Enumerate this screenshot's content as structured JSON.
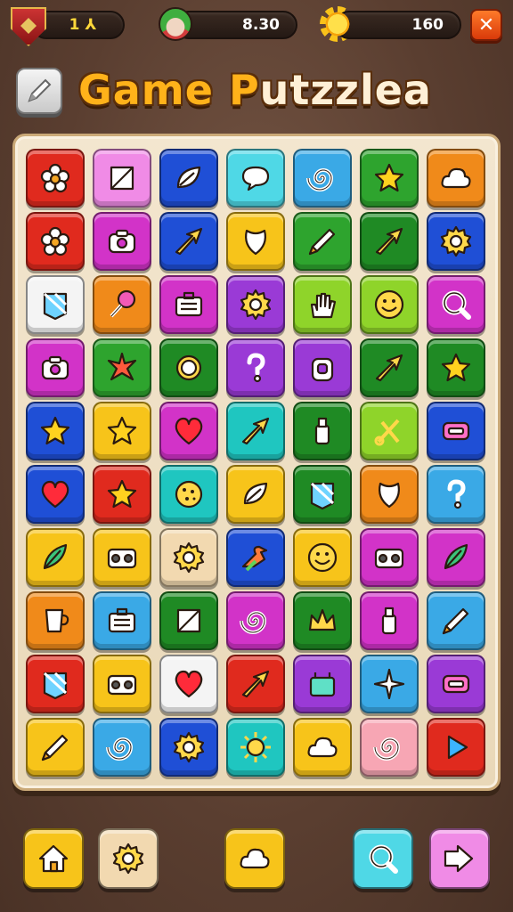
{
  "hud": {
    "level_value": "1 ⅄",
    "lives_value": "8.30",
    "coins_value": "160",
    "close_label": "✕"
  },
  "title": {
    "part1": "Game ",
    "part2_highlight": "P",
    "part2_rest": "utzzlea"
  },
  "colors": {
    "red": "#e02a1e",
    "pink": "#f08be6",
    "blue": "#1f4fd6",
    "cyan": "#4fd8e6",
    "sky": "#3aa9e6",
    "green": "#2ea42e",
    "orange": "#f08a1a",
    "yellow": "#f7c41a",
    "magenta": "#d233c8",
    "lime": "#8fd42a",
    "white": "#f4f4f4",
    "purple": "#9a3ad6",
    "beige": "#f2d9b0",
    "dkgreen": "#1f8a24",
    "teal": "#1fc6c0",
    "rose": "#f7a6b4"
  },
  "board": {
    "rows": [
      [
        {
          "c": "red",
          "i": "flower-icon"
        },
        {
          "c": "pink",
          "i": "box-icon"
        },
        {
          "c": "blue",
          "i": "leaf-icon"
        },
        {
          "c": "cyan",
          "i": "speech-icon"
        },
        {
          "c": "sky",
          "i": "swirl-icon"
        },
        {
          "c": "green",
          "i": "star-icon"
        },
        {
          "c": "orange",
          "i": "cloud-icon"
        }
      ],
      [
        {
          "c": "red",
          "i": "flower-icon"
        },
        {
          "c": "magenta",
          "i": "camera-icon"
        },
        {
          "c": "blue",
          "i": "arrow-icon"
        },
        {
          "c": "yellow",
          "i": "petal-icon"
        },
        {
          "c": "green",
          "i": "pencil-icon"
        },
        {
          "c": "dkgreen",
          "i": "arrow-icon"
        },
        {
          "c": "blue",
          "i": "gear-icon"
        }
      ],
      [
        {
          "c": "white",
          "i": "gem-icon"
        },
        {
          "c": "orange",
          "i": "lollipop-icon"
        },
        {
          "c": "magenta",
          "i": "briefcase-icon"
        },
        {
          "c": "purple",
          "i": "gear-icon"
        },
        {
          "c": "lime",
          "i": "hand-icon"
        },
        {
          "c": "lime",
          "i": "smiley-icon"
        },
        {
          "c": "magenta",
          "i": "magnifier-icon"
        }
      ],
      [
        {
          "c": "magenta",
          "i": "camera-icon"
        },
        {
          "c": "green",
          "i": "starfish-icon"
        },
        {
          "c": "dkgreen",
          "i": "ring-icon"
        },
        {
          "c": "purple",
          "i": "question-icon"
        },
        {
          "c": "purple",
          "i": "lock-icon"
        },
        {
          "c": "dkgreen",
          "i": "arrow-icon"
        },
        {
          "c": "dkgreen",
          "i": "star-icon"
        }
      ],
      [
        {
          "c": "blue",
          "i": "star-icon"
        },
        {
          "c": "yellow",
          "i": "star-icon"
        },
        {
          "c": "magenta",
          "i": "heart-icon"
        },
        {
          "c": "teal",
          "i": "arrow-icon"
        },
        {
          "c": "dkgreen",
          "i": "bottle-icon"
        },
        {
          "c": "lime",
          "i": "scissors-icon"
        },
        {
          "c": "blue",
          "i": "tag-icon"
        }
      ],
      [
        {
          "c": "blue",
          "i": "heart-icon"
        },
        {
          "c": "red",
          "i": "star-icon"
        },
        {
          "c": "teal",
          "i": "cookie-icon"
        },
        {
          "c": "yellow",
          "i": "leaf-icon"
        },
        {
          "c": "dkgreen",
          "i": "gem-icon"
        },
        {
          "c": "orange",
          "i": "petal-icon"
        },
        {
          "c": "sky",
          "i": "question-icon"
        }
      ],
      [
        {
          "c": "yellow",
          "i": "feather-icon"
        },
        {
          "c": "yellow",
          "i": "radio-icon"
        },
        {
          "c": "beige",
          "i": "gear-icon"
        },
        {
          "c": "blue",
          "i": "bird-icon"
        },
        {
          "c": "yellow",
          "i": "smiley-icon"
        },
        {
          "c": "magenta",
          "i": "radio-icon"
        },
        {
          "c": "magenta",
          "i": "feather-icon"
        }
      ],
      [
        {
          "c": "orange",
          "i": "cup-icon"
        },
        {
          "c": "sky",
          "i": "briefcase-icon"
        },
        {
          "c": "dkgreen",
          "i": "box-icon"
        },
        {
          "c": "magenta",
          "i": "swirl-icon"
        },
        {
          "c": "dkgreen",
          "i": "crown-icon"
        },
        {
          "c": "magenta",
          "i": "bottle-icon"
        },
        {
          "c": "sky",
          "i": "pencil-icon"
        }
      ],
      [
        {
          "c": "red",
          "i": "gem-icon"
        },
        {
          "c": "yellow",
          "i": "radio-icon"
        },
        {
          "c": "white",
          "i": "heart-icon"
        },
        {
          "c": "red",
          "i": "arrow-icon"
        },
        {
          "c": "purple",
          "i": "bag-icon"
        },
        {
          "c": "sky",
          "i": "sparkle-icon"
        },
        {
          "c": "purple",
          "i": "tag-icon"
        }
      ],
      [
        {
          "c": "yellow",
          "i": "pencil-icon"
        },
        {
          "c": "sky",
          "i": "swirl-icon"
        },
        {
          "c": "blue",
          "i": "gear-icon"
        },
        {
          "c": "teal",
          "i": "sun-icon"
        },
        {
          "c": "yellow",
          "i": "cloud-icon"
        },
        {
          "c": "rose",
          "i": "swirl-icon"
        },
        {
          "c": "red",
          "i": "play-icon"
        }
      ]
    ]
  },
  "bottom_bar": [
    {
      "name": "home-button",
      "c": "yellow",
      "i": "home-icon"
    },
    {
      "name": "settings-button",
      "c": "beige",
      "i": "gear-icon"
    },
    {
      "name": "hint-button",
      "c": "yellow",
      "i": "cloud-icon"
    },
    {
      "name": "search-button",
      "c": "cyan",
      "i": "magnifier-icon"
    },
    {
      "name": "next-button",
      "c": "pink",
      "i": "next-icon"
    }
  ]
}
